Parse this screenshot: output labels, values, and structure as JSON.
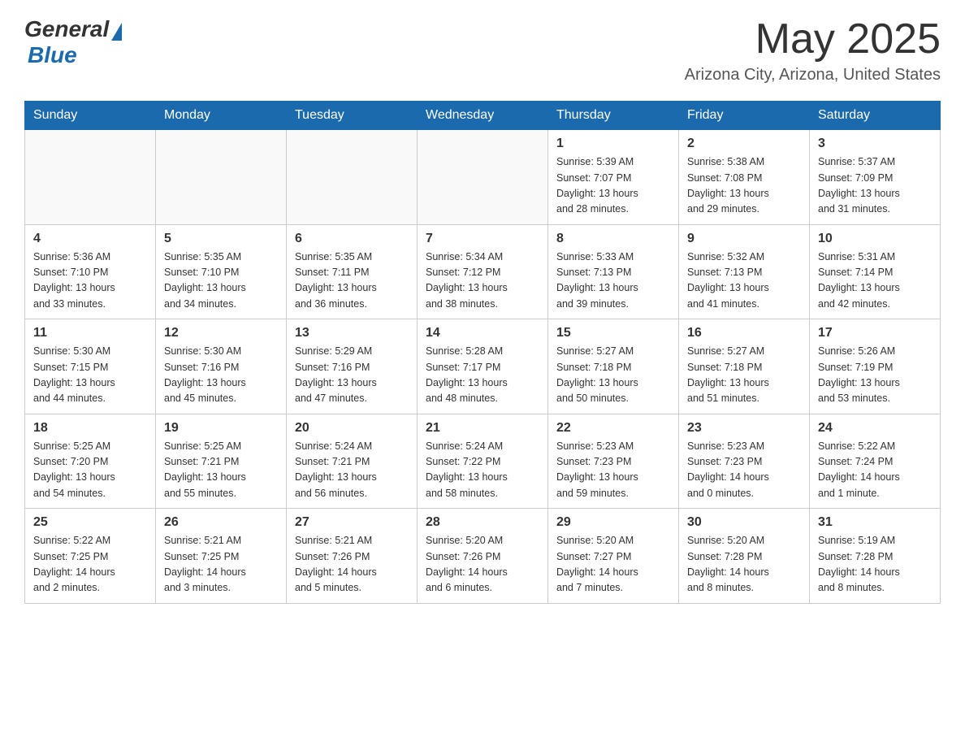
{
  "header": {
    "logo": {
      "general": "General",
      "blue": "Blue",
      "tagline": "GeneralBlue"
    },
    "title": "May 2025",
    "location": "Arizona City, Arizona, United States"
  },
  "calendar": {
    "days_of_week": [
      "Sunday",
      "Monday",
      "Tuesday",
      "Wednesday",
      "Thursday",
      "Friday",
      "Saturday"
    ],
    "weeks": [
      [
        {
          "day": "",
          "info": ""
        },
        {
          "day": "",
          "info": ""
        },
        {
          "day": "",
          "info": ""
        },
        {
          "day": "",
          "info": ""
        },
        {
          "day": "1",
          "info": "Sunrise: 5:39 AM\nSunset: 7:07 PM\nDaylight: 13 hours\nand 28 minutes."
        },
        {
          "day": "2",
          "info": "Sunrise: 5:38 AM\nSunset: 7:08 PM\nDaylight: 13 hours\nand 29 minutes."
        },
        {
          "day": "3",
          "info": "Sunrise: 5:37 AM\nSunset: 7:09 PM\nDaylight: 13 hours\nand 31 minutes."
        }
      ],
      [
        {
          "day": "4",
          "info": "Sunrise: 5:36 AM\nSunset: 7:10 PM\nDaylight: 13 hours\nand 33 minutes."
        },
        {
          "day": "5",
          "info": "Sunrise: 5:35 AM\nSunset: 7:10 PM\nDaylight: 13 hours\nand 34 minutes."
        },
        {
          "day": "6",
          "info": "Sunrise: 5:35 AM\nSunset: 7:11 PM\nDaylight: 13 hours\nand 36 minutes."
        },
        {
          "day": "7",
          "info": "Sunrise: 5:34 AM\nSunset: 7:12 PM\nDaylight: 13 hours\nand 38 minutes."
        },
        {
          "day": "8",
          "info": "Sunrise: 5:33 AM\nSunset: 7:13 PM\nDaylight: 13 hours\nand 39 minutes."
        },
        {
          "day": "9",
          "info": "Sunrise: 5:32 AM\nSunset: 7:13 PM\nDaylight: 13 hours\nand 41 minutes."
        },
        {
          "day": "10",
          "info": "Sunrise: 5:31 AM\nSunset: 7:14 PM\nDaylight: 13 hours\nand 42 minutes."
        }
      ],
      [
        {
          "day": "11",
          "info": "Sunrise: 5:30 AM\nSunset: 7:15 PM\nDaylight: 13 hours\nand 44 minutes."
        },
        {
          "day": "12",
          "info": "Sunrise: 5:30 AM\nSunset: 7:16 PM\nDaylight: 13 hours\nand 45 minutes."
        },
        {
          "day": "13",
          "info": "Sunrise: 5:29 AM\nSunset: 7:16 PM\nDaylight: 13 hours\nand 47 minutes."
        },
        {
          "day": "14",
          "info": "Sunrise: 5:28 AM\nSunset: 7:17 PM\nDaylight: 13 hours\nand 48 minutes."
        },
        {
          "day": "15",
          "info": "Sunrise: 5:27 AM\nSunset: 7:18 PM\nDaylight: 13 hours\nand 50 minutes."
        },
        {
          "day": "16",
          "info": "Sunrise: 5:27 AM\nSunset: 7:18 PM\nDaylight: 13 hours\nand 51 minutes."
        },
        {
          "day": "17",
          "info": "Sunrise: 5:26 AM\nSunset: 7:19 PM\nDaylight: 13 hours\nand 53 minutes."
        }
      ],
      [
        {
          "day": "18",
          "info": "Sunrise: 5:25 AM\nSunset: 7:20 PM\nDaylight: 13 hours\nand 54 minutes."
        },
        {
          "day": "19",
          "info": "Sunrise: 5:25 AM\nSunset: 7:21 PM\nDaylight: 13 hours\nand 55 minutes."
        },
        {
          "day": "20",
          "info": "Sunrise: 5:24 AM\nSunset: 7:21 PM\nDaylight: 13 hours\nand 56 minutes."
        },
        {
          "day": "21",
          "info": "Sunrise: 5:24 AM\nSunset: 7:22 PM\nDaylight: 13 hours\nand 58 minutes."
        },
        {
          "day": "22",
          "info": "Sunrise: 5:23 AM\nSunset: 7:23 PM\nDaylight: 13 hours\nand 59 minutes."
        },
        {
          "day": "23",
          "info": "Sunrise: 5:23 AM\nSunset: 7:23 PM\nDaylight: 14 hours\nand 0 minutes."
        },
        {
          "day": "24",
          "info": "Sunrise: 5:22 AM\nSunset: 7:24 PM\nDaylight: 14 hours\nand 1 minute."
        }
      ],
      [
        {
          "day": "25",
          "info": "Sunrise: 5:22 AM\nSunset: 7:25 PM\nDaylight: 14 hours\nand 2 minutes."
        },
        {
          "day": "26",
          "info": "Sunrise: 5:21 AM\nSunset: 7:25 PM\nDaylight: 14 hours\nand 3 minutes."
        },
        {
          "day": "27",
          "info": "Sunrise: 5:21 AM\nSunset: 7:26 PM\nDaylight: 14 hours\nand 5 minutes."
        },
        {
          "day": "28",
          "info": "Sunrise: 5:20 AM\nSunset: 7:26 PM\nDaylight: 14 hours\nand 6 minutes."
        },
        {
          "day": "29",
          "info": "Sunrise: 5:20 AM\nSunset: 7:27 PM\nDaylight: 14 hours\nand 7 minutes."
        },
        {
          "day": "30",
          "info": "Sunrise: 5:20 AM\nSunset: 7:28 PM\nDaylight: 14 hours\nand 8 minutes."
        },
        {
          "day": "31",
          "info": "Sunrise: 5:19 AM\nSunset: 7:28 PM\nDaylight: 14 hours\nand 8 minutes."
        }
      ]
    ]
  }
}
